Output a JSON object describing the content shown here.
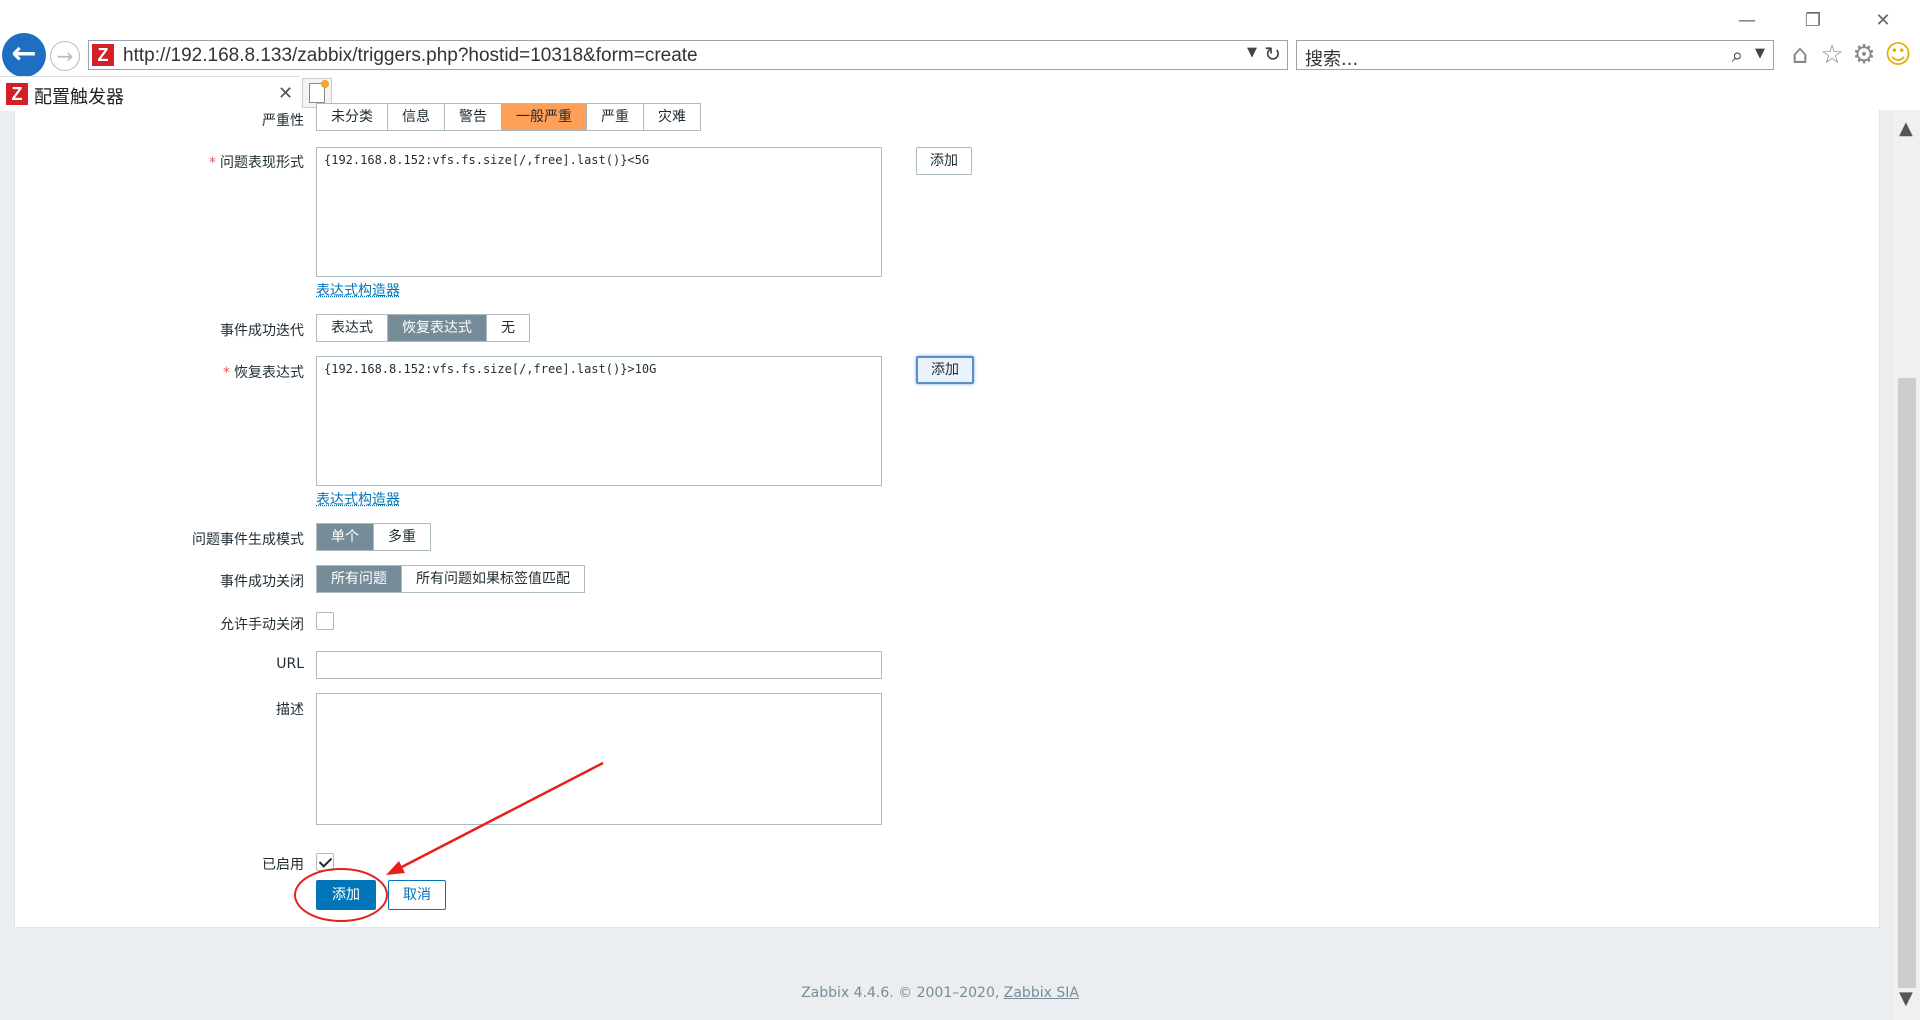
{
  "browser": {
    "url": "http://192.168.8.133/zabbix/triggers.php?hostid=10318&form=create",
    "search_placeholder": "搜索...",
    "tab_title": "配置触发器",
    "logo_letter": "Z"
  },
  "form": {
    "severity": {
      "label": "严重性",
      "options": [
        "未分类",
        "信息",
        "警告",
        "一般严重",
        "严重",
        "灾难"
      ],
      "selected": "一般严重"
    },
    "problem_expression": {
      "label": "问题表现形式",
      "value": "{192.168.8.152:vfs.fs.size[/,free].last()}<5G",
      "add_button": "添加",
      "constructor_link": "表达式构造器"
    },
    "ok_event_generation": {
      "label": "事件成功迭代",
      "options": [
        "表达式",
        "恢复表达式",
        "无"
      ],
      "selected": "恢复表达式"
    },
    "recovery_expression": {
      "label": "恢复表达式",
      "value": "{192.168.8.152:vfs.fs.size[/,free].last()}>10G",
      "add_button": "添加",
      "constructor_link": "表达式构造器"
    },
    "problem_event_mode": {
      "label": "问题事件生成模式",
      "options": [
        "单个",
        "多重"
      ],
      "selected": "单个"
    },
    "ok_event_closes": {
      "label": "事件成功关闭",
      "options": [
        "所有问题",
        "所有问题如果标签值匹配"
      ],
      "selected": "所有问题"
    },
    "manual_close": {
      "label": "允许手动关闭",
      "checked": false
    },
    "url": {
      "label": "URL",
      "value": ""
    },
    "description": {
      "label": "描述",
      "value": ""
    },
    "enabled": {
      "label": "已启用",
      "checked": true
    },
    "submit_button": "添加",
    "cancel_button": "取消"
  },
  "footer": {
    "text": "Zabbix 4.4.6. © 2001–2020, ",
    "link": "Zabbix SIA"
  },
  "colors": {
    "primary": "#0275b8",
    "segment_selected": "#768d99",
    "severity_average": "#ffa059",
    "annotation": "#e8201c"
  }
}
